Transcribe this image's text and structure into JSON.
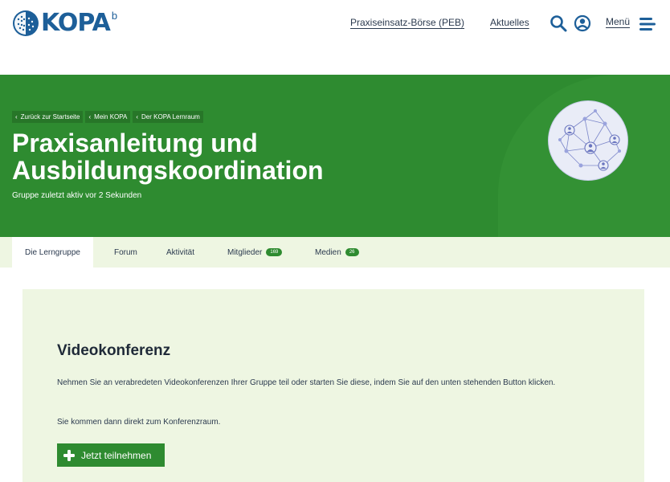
{
  "brand": {
    "name": "KOPA",
    "superscript": "b"
  },
  "nav": {
    "peb": "Praxiseinsatz-Börse (PEB)",
    "news": "Aktuelles",
    "menu": "Menü"
  },
  "breadcrumb": [
    "Zurück zur Startseite",
    "Mein KOPA",
    "Der KOPA Lernraum"
  ],
  "hero": {
    "title": "Praxisanleitung und Ausbildungskoordination",
    "subtitle": "Gruppe zuletzt aktiv vor 2 Sekunden"
  },
  "tabs": [
    {
      "label": "Die Lerngruppe"
    },
    {
      "label": "Forum"
    },
    {
      "label": "Aktivität"
    },
    {
      "label": "Mitglieder",
      "count": "169"
    },
    {
      "label": "Medien",
      "count": "26"
    }
  ],
  "video": {
    "title": "Videokonferenz",
    "paragraph1": "Nehmen Sie an verabredeten Videokonferenzen Ihrer Gruppe teil oder starten Sie diese, indem Sie auf den unten stehenden Button klicken.",
    "paragraph2": "Sie kommen dann direkt zum Konferenzraum.",
    "button": "Jetzt teilnehmen"
  },
  "colors": {
    "brand_blue": "#1d5f99",
    "hero_green": "#2e8b30",
    "light_green": "#eef6e2"
  },
  "icons": {
    "search": "search-icon",
    "user": "user-circle-icon",
    "menu": "hamburger-icon",
    "join": "plus-icon"
  }
}
